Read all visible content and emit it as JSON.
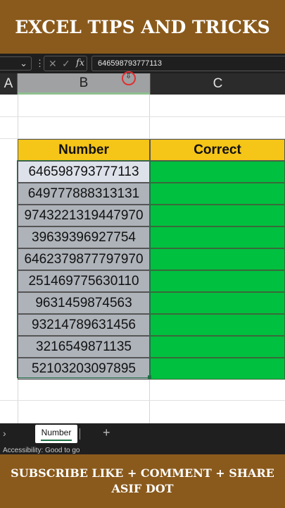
{
  "banner_top": {
    "title": "EXCEL TIPS AND TRICKS"
  },
  "formula_bar": {
    "cancel_icon": "close-icon",
    "enter_icon": "check-icon",
    "fx_label": "fx",
    "value": "646598793777113"
  },
  "columns": [
    {
      "label": "A"
    },
    {
      "label": "B"
    },
    {
      "label": "C"
    }
  ],
  "table": {
    "headers": [
      "Number",
      "Correct"
    ],
    "rows": [
      "646598793777113",
      "649777888313131",
      "9743221319447970",
      "39639396927754",
      "6462379877797970",
      "251469775630110",
      "9631459874563",
      "93214789631456",
      "3216549871135",
      "52103203097895"
    ]
  },
  "colors": {
    "banner": "#8a5a1c",
    "header_fill": "#f5c518",
    "correct_fill": "#00c040",
    "selected_fill": "#aeb3ba"
  },
  "sheets": {
    "active": "Number",
    "add_icon": "plus-icon"
  },
  "status": {
    "text": "Accessibility: Good to go"
  },
  "banner_bottom": {
    "line1": "SUBSCRIBE LIKE + COMMENT + SHARE",
    "line2": "ASIF DOT"
  }
}
